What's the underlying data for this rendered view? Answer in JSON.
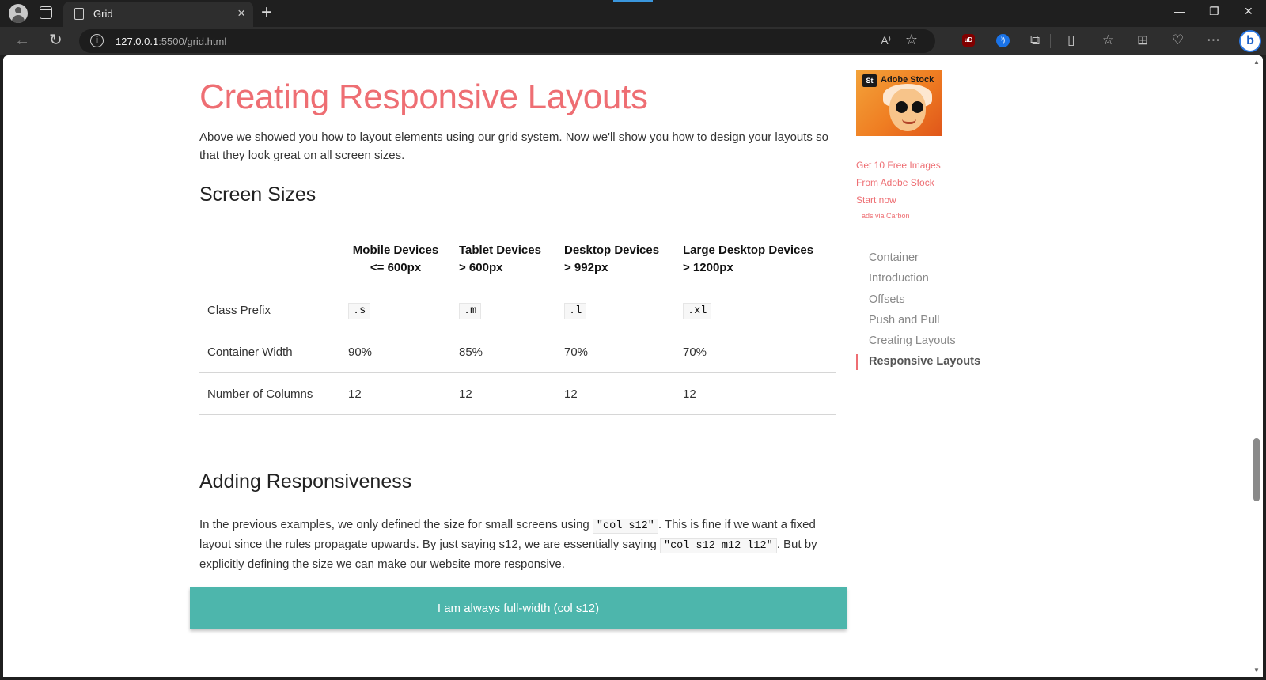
{
  "browser": {
    "tab_title": "Grid",
    "url_host": "127.0.0.1",
    "url_path": ":5500/grid.html",
    "minimize": "—",
    "restore": "❐",
    "close": "✕",
    "read_aloud": "A⁾",
    "ext_red_label": "uD",
    "ext_blue_label": "⁾)",
    "bing_label": "b"
  },
  "page": {
    "title": "Creating Responsive Layouts",
    "intro": "Above we showed you how to layout elements using our grid system. Now we'll show you how to design your layouts so that they look great on all screen sizes.",
    "screen_sizes_heading": "Screen Sizes",
    "table": {
      "headers": [
        {
          "line1": "",
          "line2": ""
        },
        {
          "line1": "Mobile Devices",
          "line2": "<= 600px"
        },
        {
          "line1": "Tablet Devices",
          "line2": "> 600px"
        },
        {
          "line1": "Desktop Devices",
          "line2": "> 992px"
        },
        {
          "line1": "Large Desktop Devices",
          "line2": "> 1200px"
        }
      ],
      "rows": [
        {
          "label": "Class Prefix",
          "cells": [
            ".s",
            ".m",
            ".l",
            ".xl"
          ]
        },
        {
          "label": "Container Width",
          "cells": [
            "90%",
            "85%",
            "70%",
            "70%"
          ]
        },
        {
          "label": "Number of Columns",
          "cells": [
            "12",
            "12",
            "12",
            "12"
          ]
        }
      ]
    },
    "adding_heading": "Adding Responsiveness",
    "para": {
      "t1": "In the previous examples, we only defined the size for small screens using ",
      "code1": "\"col s12\"",
      "t2": ". This is fine if we want a fixed layout since the rules propagate upwards. By just saying s12, we are essentially saying ",
      "code2": "\"col s12 m12 l12\"",
      "t3": ". But by explicitly defining the size we can make our website more responsive."
    },
    "fullwidth_box": "I am always full-width (col s12)"
  },
  "sidebar": {
    "ad_badge": "St",
    "ad_brand": "Adobe Stock",
    "ad_line1": "Get 10 Free Images",
    "ad_line2": "From Adobe Stock",
    "ad_line3": "Start now",
    "ad_via": "ads via Carbon",
    "toc": [
      "Container",
      "Introduction",
      "Offsets",
      "Push and Pull",
      "Creating Layouts",
      "Responsive Layouts"
    ],
    "toc_active": "Responsive Layouts"
  },
  "colors": {
    "accent": "#ee6e73",
    "teal": "#4db6ac"
  }
}
